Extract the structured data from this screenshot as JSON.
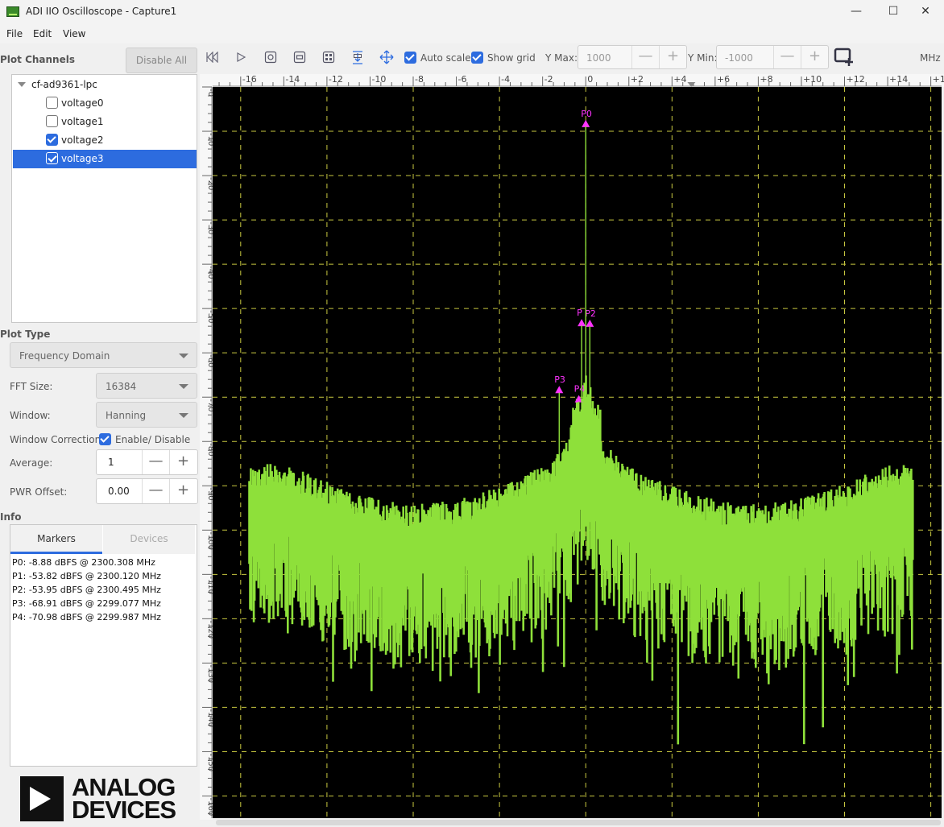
{
  "window": {
    "title": "ADI IIO Oscilloscope - Capture1",
    "minimize": "—",
    "maximize": "☐",
    "close": "✕"
  },
  "menu": [
    "File",
    "Edit",
    "View"
  ],
  "left": {
    "plot_channels_label": "Plot Channels",
    "disable_all": "Disable All",
    "device": "cf-ad9361-lpc",
    "channels": [
      {
        "name": "voltage0",
        "checked": false
      },
      {
        "name": "voltage1",
        "checked": false
      },
      {
        "name": "voltage2",
        "checked": true
      },
      {
        "name": "voltage3",
        "checked": true
      }
    ],
    "plot_type_label": "Plot Type",
    "plot_type": "Frequency Domain",
    "fft_size_label": "FFT Size:",
    "fft_size": "16384",
    "window_label": "Window:",
    "window": "Hanning",
    "window_correction_label": "Window Correction:",
    "window_correction_option": "Enable/ Disable",
    "average_label": "Average:",
    "average": "1",
    "pwr_offset_label": "PWR Offset:",
    "pwr_offset": "0.00",
    "info_label": "Info",
    "tabs": [
      "Markers",
      "Devices"
    ],
    "markers": [
      "P0: -8.88 dBFS @ 2300.308 MHz",
      "P1: -53.82 dBFS @ 2300.120 MHz",
      "P2: -53.95 dBFS @ 2300.495 MHz",
      "P3: -68.91 dBFS @ 2299.077 MHz",
      "P4: -70.98 dBFS @ 2299.987 MHz"
    ],
    "logo_line1": "ANALOG",
    "logo_line2": "DEVICES"
  },
  "toolbar": {
    "auto_scale": "Auto scale",
    "show_grid": "Show grid",
    "ymax_label": "Y Max:",
    "ymax": "1000",
    "ymin_label": "Y Min:",
    "ymin": "-1000",
    "unit": "MHz",
    "minus": "—",
    "plus": "+"
  },
  "plot": {
    "background": "#000000",
    "trace_color": "#8ee03a",
    "marker_color": "#ff33ff",
    "grid_color": "#c8c840",
    "x_ticks": [
      -16,
      -14,
      -12,
      -10,
      -8,
      -6,
      -4,
      -2,
      0,
      2,
      4,
      6,
      8,
      10,
      12,
      14,
      16
    ],
    "y_ticks": [
      0,
      10,
      20,
      30,
      40,
      50,
      60,
      70,
      80,
      90,
      100,
      110,
      120,
      130,
      140,
      150,
      160
    ],
    "marker_labels": [
      {
        "label": "P0",
        "x_mhz": 0.0,
        "dbfs": -8.88
      },
      {
        "label": "P",
        "x_mhz": -0.19,
        "dbfs": -53.82
      },
      {
        "label": "P2",
        "x_mhz": 0.19,
        "dbfs": -53.95
      },
      {
        "label": "P3",
        "x_mhz": -1.23,
        "dbfs": -68.91
      },
      {
        "label": "P4",
        "x_mhz": -0.32,
        "dbfs": -70.98
      }
    ]
  }
}
